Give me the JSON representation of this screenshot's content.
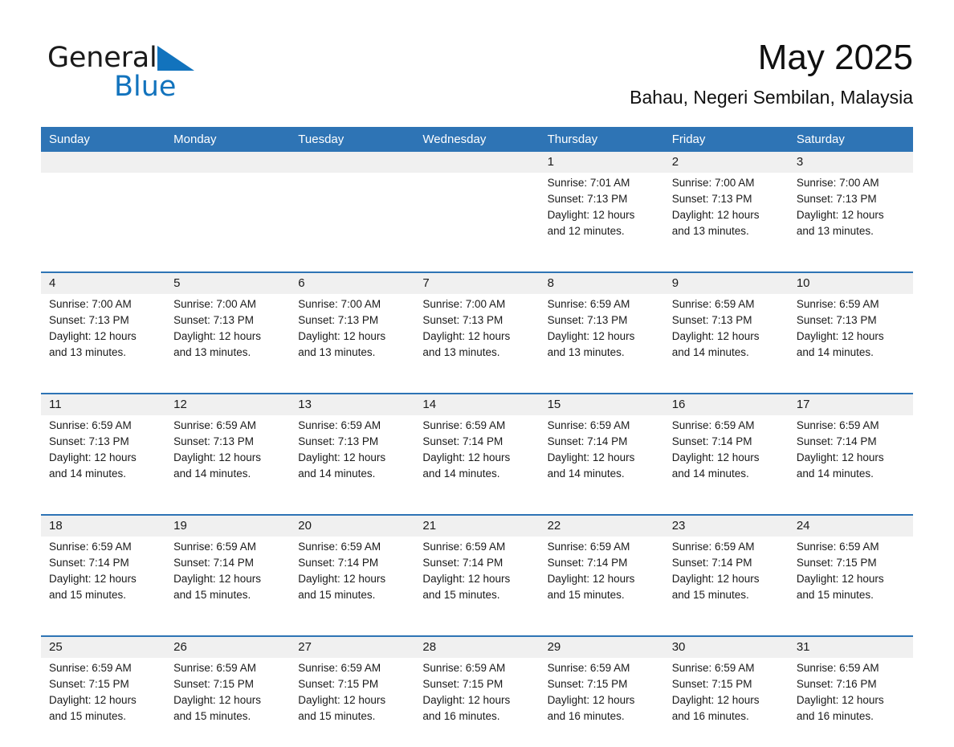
{
  "brand": {
    "name_part1": "General",
    "name_part2": "Blue",
    "triangle_color": "#1273bd",
    "accent_color": "#2E74B5"
  },
  "header": {
    "month_title": "May 2025",
    "location": "Bahau, Negeri Sembilan, Malaysia"
  },
  "calendar": {
    "weekday_headers": [
      "Sunday",
      "Monday",
      "Tuesday",
      "Wednesday",
      "Thursday",
      "Friday",
      "Saturday"
    ],
    "weeks": [
      [
        {
          "day": "",
          "lines": [
            "",
            "",
            "",
            ""
          ]
        },
        {
          "day": "",
          "lines": [
            "",
            "",
            "",
            ""
          ]
        },
        {
          "day": "",
          "lines": [
            "",
            "",
            "",
            ""
          ]
        },
        {
          "day": "",
          "lines": [
            "",
            "",
            "",
            ""
          ]
        },
        {
          "day": "1",
          "lines": [
            "Sunrise: 7:01 AM",
            "Sunset: 7:13 PM",
            "Daylight: 12 hours",
            "and 12 minutes."
          ]
        },
        {
          "day": "2",
          "lines": [
            "Sunrise: 7:00 AM",
            "Sunset: 7:13 PM",
            "Daylight: 12 hours",
            "and 13 minutes."
          ]
        },
        {
          "day": "3",
          "lines": [
            "Sunrise: 7:00 AM",
            "Sunset: 7:13 PM",
            "Daylight: 12 hours",
            "and 13 minutes."
          ]
        }
      ],
      [
        {
          "day": "4",
          "lines": [
            "Sunrise: 7:00 AM",
            "Sunset: 7:13 PM",
            "Daylight: 12 hours",
            "and 13 minutes."
          ]
        },
        {
          "day": "5",
          "lines": [
            "Sunrise: 7:00 AM",
            "Sunset: 7:13 PM",
            "Daylight: 12 hours",
            "and 13 minutes."
          ]
        },
        {
          "day": "6",
          "lines": [
            "Sunrise: 7:00 AM",
            "Sunset: 7:13 PM",
            "Daylight: 12 hours",
            "and 13 minutes."
          ]
        },
        {
          "day": "7",
          "lines": [
            "Sunrise: 7:00 AM",
            "Sunset: 7:13 PM",
            "Daylight: 12 hours",
            "and 13 minutes."
          ]
        },
        {
          "day": "8",
          "lines": [
            "Sunrise: 6:59 AM",
            "Sunset: 7:13 PM",
            "Daylight: 12 hours",
            "and 13 minutes."
          ]
        },
        {
          "day": "9",
          "lines": [
            "Sunrise: 6:59 AM",
            "Sunset: 7:13 PM",
            "Daylight: 12 hours",
            "and 14 minutes."
          ]
        },
        {
          "day": "10",
          "lines": [
            "Sunrise: 6:59 AM",
            "Sunset: 7:13 PM",
            "Daylight: 12 hours",
            "and 14 minutes."
          ]
        }
      ],
      [
        {
          "day": "11",
          "lines": [
            "Sunrise: 6:59 AM",
            "Sunset: 7:13 PM",
            "Daylight: 12 hours",
            "and 14 minutes."
          ]
        },
        {
          "day": "12",
          "lines": [
            "Sunrise: 6:59 AM",
            "Sunset: 7:13 PM",
            "Daylight: 12 hours",
            "and 14 minutes."
          ]
        },
        {
          "day": "13",
          "lines": [
            "Sunrise: 6:59 AM",
            "Sunset: 7:13 PM",
            "Daylight: 12 hours",
            "and 14 minutes."
          ]
        },
        {
          "day": "14",
          "lines": [
            "Sunrise: 6:59 AM",
            "Sunset: 7:14 PM",
            "Daylight: 12 hours",
            "and 14 minutes."
          ]
        },
        {
          "day": "15",
          "lines": [
            "Sunrise: 6:59 AM",
            "Sunset: 7:14 PM",
            "Daylight: 12 hours",
            "and 14 minutes."
          ]
        },
        {
          "day": "16",
          "lines": [
            "Sunrise: 6:59 AM",
            "Sunset: 7:14 PM",
            "Daylight: 12 hours",
            "and 14 minutes."
          ]
        },
        {
          "day": "17",
          "lines": [
            "Sunrise: 6:59 AM",
            "Sunset: 7:14 PM",
            "Daylight: 12 hours",
            "and 14 minutes."
          ]
        }
      ],
      [
        {
          "day": "18",
          "lines": [
            "Sunrise: 6:59 AM",
            "Sunset: 7:14 PM",
            "Daylight: 12 hours",
            "and 15 minutes."
          ]
        },
        {
          "day": "19",
          "lines": [
            "Sunrise: 6:59 AM",
            "Sunset: 7:14 PM",
            "Daylight: 12 hours",
            "and 15 minutes."
          ]
        },
        {
          "day": "20",
          "lines": [
            "Sunrise: 6:59 AM",
            "Sunset: 7:14 PM",
            "Daylight: 12 hours",
            "and 15 minutes."
          ]
        },
        {
          "day": "21",
          "lines": [
            "Sunrise: 6:59 AM",
            "Sunset: 7:14 PM",
            "Daylight: 12 hours",
            "and 15 minutes."
          ]
        },
        {
          "day": "22",
          "lines": [
            "Sunrise: 6:59 AM",
            "Sunset: 7:14 PM",
            "Daylight: 12 hours",
            "and 15 minutes."
          ]
        },
        {
          "day": "23",
          "lines": [
            "Sunrise: 6:59 AM",
            "Sunset: 7:14 PM",
            "Daylight: 12 hours",
            "and 15 minutes."
          ]
        },
        {
          "day": "24",
          "lines": [
            "Sunrise: 6:59 AM",
            "Sunset: 7:15 PM",
            "Daylight: 12 hours",
            "and 15 minutes."
          ]
        }
      ],
      [
        {
          "day": "25",
          "lines": [
            "Sunrise: 6:59 AM",
            "Sunset: 7:15 PM",
            "Daylight: 12 hours",
            "and 15 minutes."
          ]
        },
        {
          "day": "26",
          "lines": [
            "Sunrise: 6:59 AM",
            "Sunset: 7:15 PM",
            "Daylight: 12 hours",
            "and 15 minutes."
          ]
        },
        {
          "day": "27",
          "lines": [
            "Sunrise: 6:59 AM",
            "Sunset: 7:15 PM",
            "Daylight: 12 hours",
            "and 15 minutes."
          ]
        },
        {
          "day": "28",
          "lines": [
            "Sunrise: 6:59 AM",
            "Sunset: 7:15 PM",
            "Daylight: 12 hours",
            "and 16 minutes."
          ]
        },
        {
          "day": "29",
          "lines": [
            "Sunrise: 6:59 AM",
            "Sunset: 7:15 PM",
            "Daylight: 12 hours",
            "and 16 minutes."
          ]
        },
        {
          "day": "30",
          "lines": [
            "Sunrise: 6:59 AM",
            "Sunset: 7:15 PM",
            "Daylight: 12 hours",
            "and 16 minutes."
          ]
        },
        {
          "day": "31",
          "lines": [
            "Sunrise: 6:59 AM",
            "Sunset: 7:16 PM",
            "Daylight: 12 hours",
            "and 16 minutes."
          ]
        }
      ]
    ]
  }
}
